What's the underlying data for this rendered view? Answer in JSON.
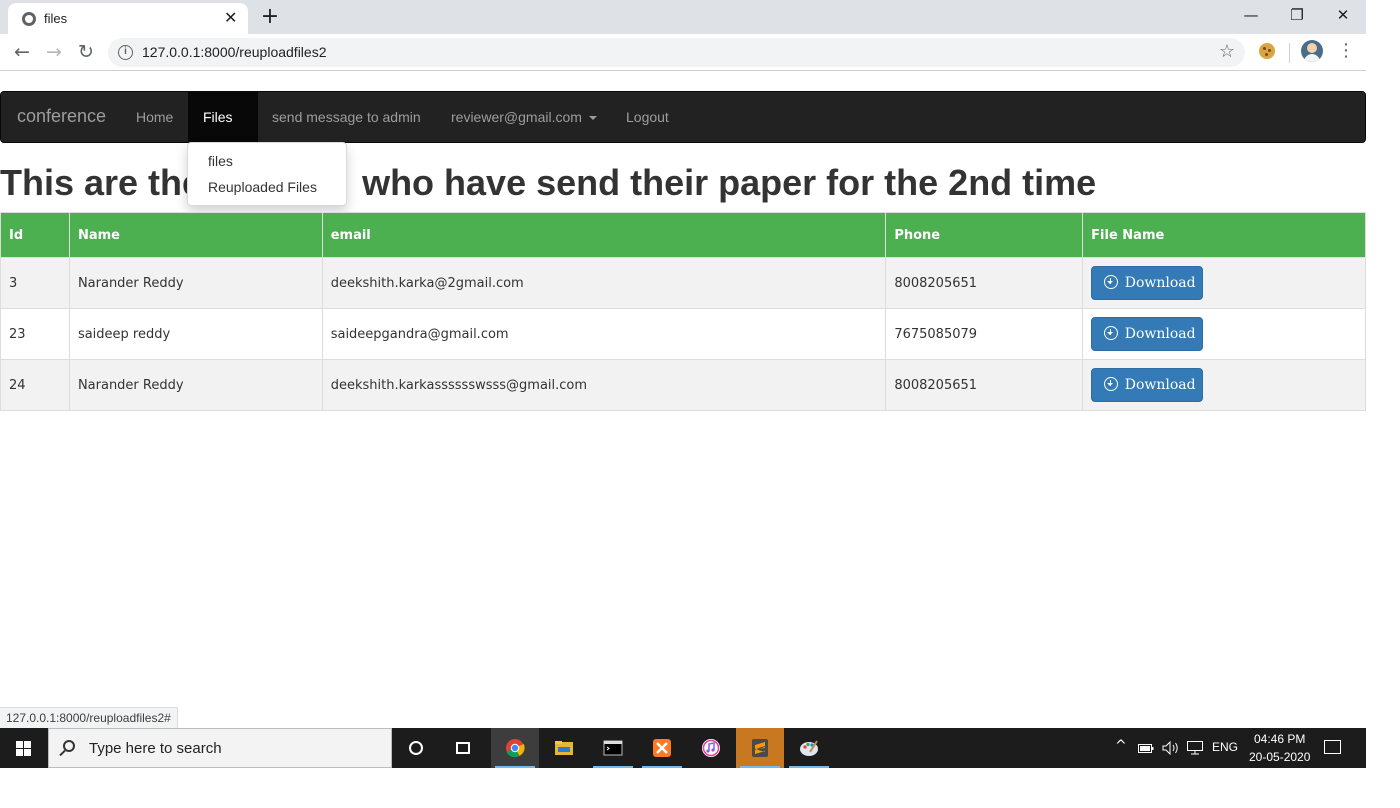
{
  "browser": {
    "tab_title": "files",
    "tab_close": "✕",
    "new_tab": "+",
    "url": "127.0.0.1:8000/reuploadfiles2",
    "status_url": "127.0.0.1:8000/reuploadfiles2#",
    "back": "←",
    "forward": "→",
    "reload": "↻",
    "minimize": "—",
    "restore": "❐",
    "close": "✕",
    "star": "☆",
    "menu": "⋮"
  },
  "navbar": {
    "brand": "conference",
    "items": [
      {
        "label": "Home"
      },
      {
        "label": "Files"
      },
      {
        "label": "send message to admin"
      },
      {
        "label": "reviewer@gmail.com"
      },
      {
        "label": "Logout"
      }
    ]
  },
  "dropdown": {
    "items": [
      "files",
      "Reuploaded Files"
    ]
  },
  "page": {
    "heading_before": "This are the",
    "heading_after": "who have send their paper for the 2nd time"
  },
  "table": {
    "headers": [
      "Id",
      "Name",
      "email",
      "Phone",
      "File Name"
    ],
    "rows": [
      {
        "id": "3",
        "name": "Narander Reddy",
        "email": "deekshith.karka@2gmail.com",
        "phone": "8008205651",
        "action": "Download"
      },
      {
        "id": "23",
        "name": "saideep reddy",
        "email": "saideepgandra@gmail.com",
        "phone": "7675085079",
        "action": "Download"
      },
      {
        "id": "24",
        "name": "Narander Reddy",
        "email": "deekshith.karkasssssswsss@gmail.com",
        "phone": "8008205651",
        "action": "Download"
      }
    ]
  },
  "taskbar": {
    "search_placeholder": "Type here to search",
    "language": "ENG",
    "time": "04:46 PM",
    "date": "20-05-2020",
    "tray_chevron": "^"
  },
  "colors": {
    "navbar_bg": "#222222",
    "table_header": "#4caf50",
    "button": "#337ab7"
  }
}
